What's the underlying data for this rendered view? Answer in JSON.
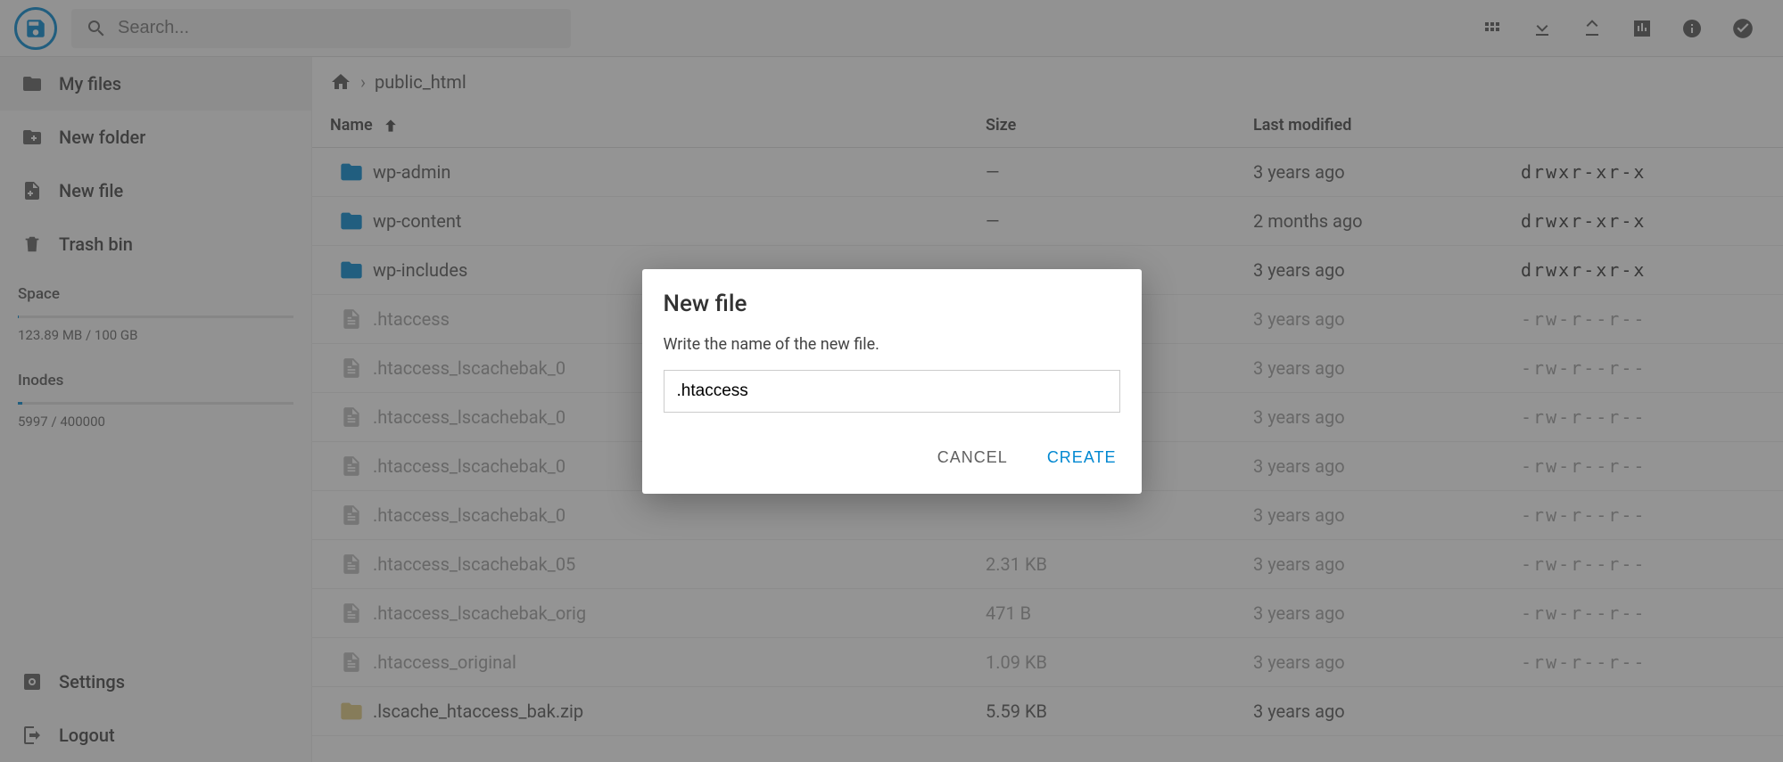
{
  "search": {
    "placeholder": "Search..."
  },
  "sidebar": {
    "items": [
      {
        "label": "My files"
      },
      {
        "label": "New folder"
      },
      {
        "label": "New file"
      },
      {
        "label": "Trash bin"
      }
    ],
    "space_label": "Space",
    "space_value": "123.89 MB / 100 GB",
    "space_fill_pct": 0.12,
    "inodes_label": "Inodes",
    "inodes_value": "5997 / 400000",
    "inodes_fill_pct": 1.5,
    "settings_label": "Settings",
    "logout_label": "Logout"
  },
  "breadcrumb": {
    "current": "public_html"
  },
  "columns": {
    "name": "Name",
    "size": "Size",
    "modified": "Last modified"
  },
  "rows": [
    {
      "type": "folder",
      "name": "wp-admin",
      "size": "—",
      "modified": "3 years ago",
      "perm": "drwxr-xr-x"
    },
    {
      "type": "folder",
      "name": "wp-content",
      "size": "—",
      "modified": "2 months ago",
      "perm": "drwxr-xr-x"
    },
    {
      "type": "folder",
      "name": "wp-includes",
      "size": "—",
      "modified": "3 years ago",
      "perm": "drwxr-xr-x"
    },
    {
      "type": "file",
      "name": ".htaccess",
      "size": "",
      "modified": "3 years ago",
      "perm": "-rw-r--r--"
    },
    {
      "type": "file",
      "name": ".htaccess_lscachebak_0",
      "size": "",
      "modified": "3 years ago",
      "perm": "-rw-r--r--"
    },
    {
      "type": "file",
      "name": ".htaccess_lscachebak_0",
      "size": "",
      "modified": "3 years ago",
      "perm": "-rw-r--r--"
    },
    {
      "type": "file",
      "name": ".htaccess_lscachebak_0",
      "size": "",
      "modified": "3 years ago",
      "perm": "-rw-r--r--"
    },
    {
      "type": "file",
      "name": ".htaccess_lscachebak_0",
      "size": "",
      "modified": "3 years ago",
      "perm": "-rw-r--r--"
    },
    {
      "type": "file",
      "name": ".htaccess_lscachebak_05",
      "size": "2.31 KB",
      "modified": "3 years ago",
      "perm": "-rw-r--r--"
    },
    {
      "type": "file",
      "name": ".htaccess_lscachebak_orig",
      "size": "471 B",
      "modified": "3 years ago",
      "perm": "-rw-r--r--"
    },
    {
      "type": "file",
      "name": ".htaccess_original",
      "size": "1.09 KB",
      "modified": "3 years ago",
      "perm": "-rw-r--r--"
    },
    {
      "type": "folder-light",
      "name": ".lscache_htaccess_bak.zip",
      "size": "5.59 KB",
      "modified": "3 years ago",
      "perm": ""
    }
  ],
  "dialog": {
    "title": "New file",
    "message": "Write the name of the new file.",
    "input_value": ".htaccess",
    "cancel": "CANCEL",
    "create": "CREATE"
  }
}
